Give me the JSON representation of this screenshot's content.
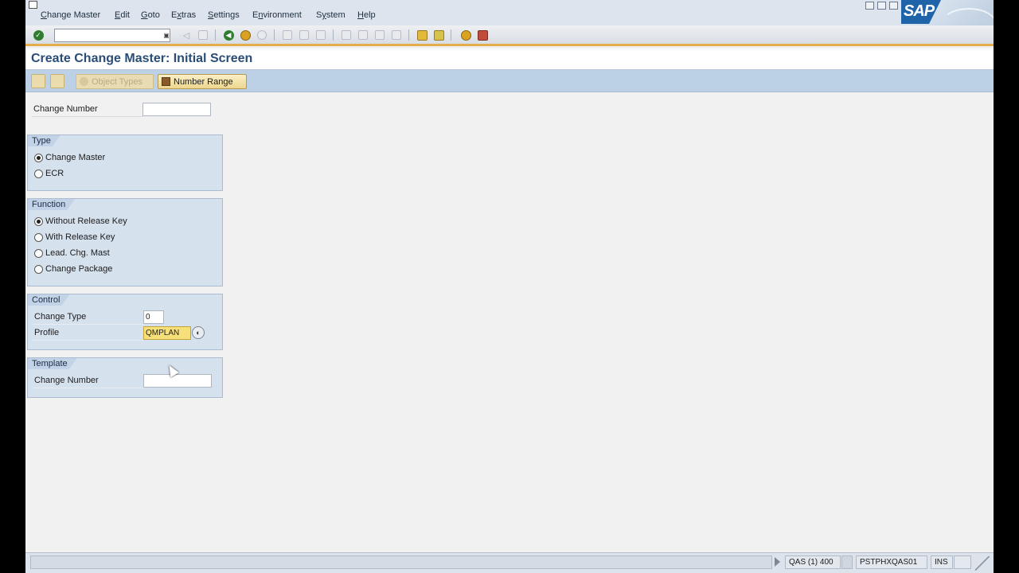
{
  "menubar": {
    "items": [
      {
        "label": "Change Master",
        "ul": "C",
        "rest": "hange Master"
      },
      {
        "label": "Edit",
        "ul": "E",
        "rest": "dit"
      },
      {
        "label": "Goto",
        "ul": "G",
        "rest": "oto"
      },
      {
        "label": "Extras",
        "ul": "x",
        "pre": "E",
        "rest": "tras"
      },
      {
        "label": "Settings",
        "ul": "S",
        "rest": "ettings"
      },
      {
        "label": "Environment",
        "ul": "n",
        "pre": "E",
        "rest": "vironment"
      },
      {
        "label": "System",
        "ul": "y",
        "pre": "S",
        "rest": "stem"
      },
      {
        "label": "Help",
        "ul": "H",
        "rest": "elp"
      }
    ],
    "logo_text": "SAP"
  },
  "toolbar": {
    "command_field": {
      "value": "",
      "placeholder": ""
    },
    "icons": [
      "enter-icon",
      "back-icon",
      "exit-icon",
      "cancel-icon",
      "print-icon",
      "find-icon",
      "find-next-icon",
      "first-page-icon",
      "previous-page-icon",
      "next-page-icon",
      "last-page-icon",
      "create-session-icon",
      "shortcut-icon",
      "help-icon",
      "customize-layout-icon"
    ]
  },
  "title": "Create Change Master: Initial Screen",
  "app_toolbar": {
    "object_types_label": "Object Types",
    "number_range_label": "Number Range"
  },
  "form": {
    "change_number_label": "Change Number",
    "change_number_value": "",
    "type_group": {
      "title": "Type",
      "options": [
        "Change Master",
        "ECR"
      ],
      "selected": "Change Master"
    },
    "function_group": {
      "title": "Function",
      "options": [
        "Without Release Key",
        "With Release Key",
        "Lead. Chg. Mast",
        "Change Package"
      ],
      "selected": "Without Release Key"
    },
    "control_group": {
      "title": "Control",
      "change_type_label": "Change Type",
      "change_type_value": "0",
      "profile_label": "Profile",
      "profile_value": "QMPLAN"
    },
    "template_group": {
      "title": "Template",
      "change_number_label": "Change Number",
      "change_number_value": ""
    }
  },
  "statusbar": {
    "message": "",
    "system": "QAS (1) 400",
    "server": "PSTPHXQAS01",
    "mode": "INS"
  },
  "colors": {
    "title": "#2a4d78",
    "app_toolbar": "#bcd0e6",
    "group_bg": "#d6e1ee",
    "profile_highlight": "#f7e07a",
    "toolbar_accent": "#e3ad4a"
  }
}
